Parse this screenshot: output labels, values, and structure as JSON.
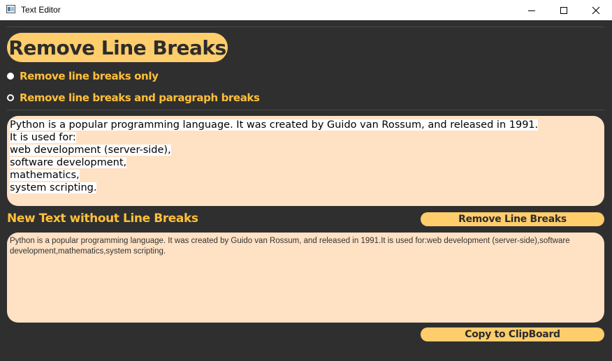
{
  "window": {
    "title": "Text Editor",
    "icon": "app-window-icon",
    "controls": [
      "minimize-icon",
      "maximize-icon",
      "close-icon"
    ]
  },
  "header": {
    "title": "Remove Line Breaks"
  },
  "options": {
    "items": [
      {
        "label": "Remove line breaks only",
        "checked": true
      },
      {
        "label": "Remove line breaks and paragraph breaks",
        "checked": false
      }
    ]
  },
  "input": {
    "lines": [
      "Python is a popular programming language. It was created by Guido van Rossum, and released in 1991.",
      "It is used for:",
      "web development (server-side),",
      "software development,",
      "mathematics,",
      "system scripting."
    ]
  },
  "output": {
    "title": "New Text without Line Breaks",
    "text": "Python is a popular programming language. It was created by Guido van Rossum, and released in 1991.It is used for:web development (server-side),software development,mathematics,system scripting."
  },
  "buttons": {
    "remove": "Remove Line Breaks",
    "copy": "Copy to ClipBoard"
  },
  "colors": {
    "background": "#2f2f2f",
    "accent": "#ffcd6b",
    "label": "#ffc03a",
    "textbox": "#ffe1c4"
  }
}
